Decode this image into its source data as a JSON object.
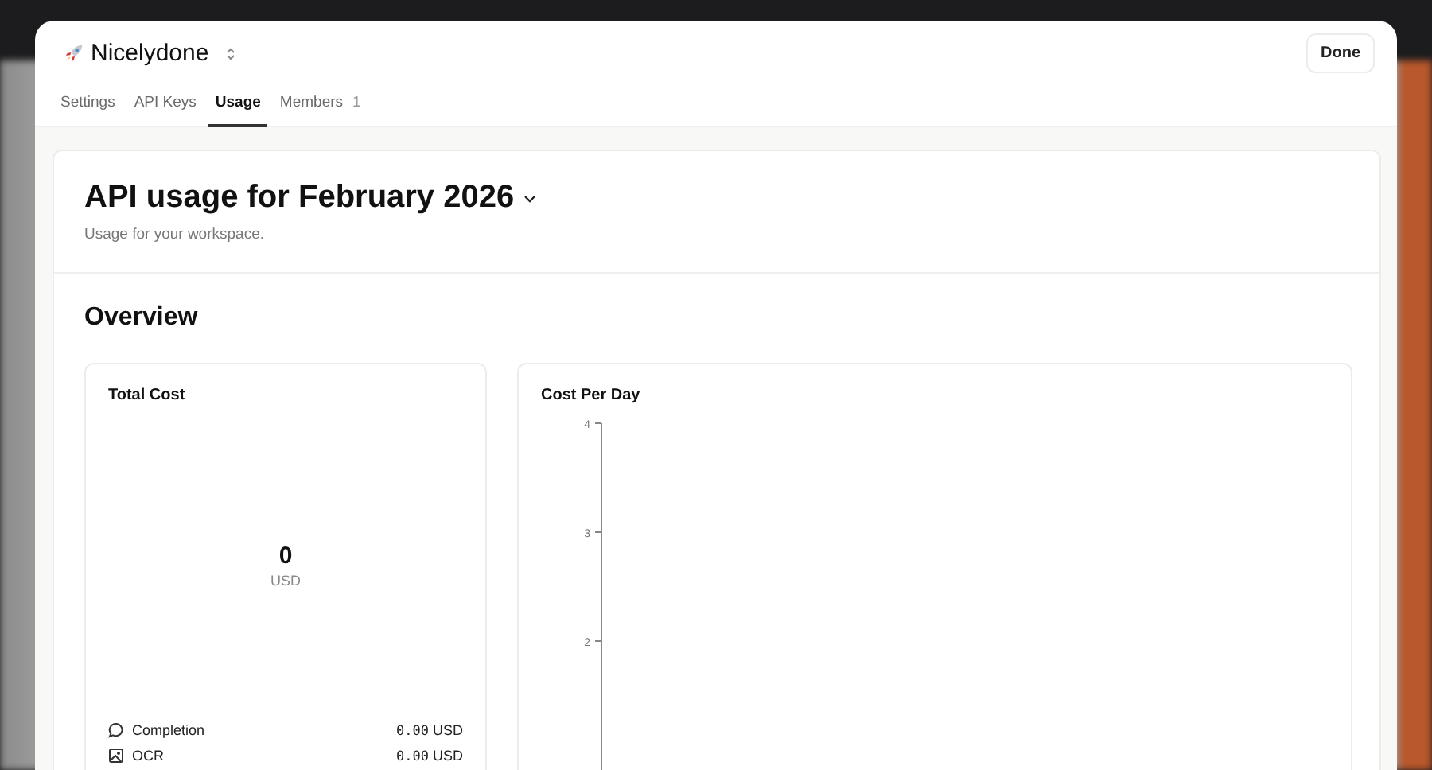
{
  "workspace": {
    "name": "Nicelydone"
  },
  "done_button": "Done",
  "tabs": [
    {
      "label": "Settings",
      "selected": false
    },
    {
      "label": "API Keys",
      "selected": false
    },
    {
      "label": "Usage",
      "selected": true
    },
    {
      "label": "Members",
      "selected": false,
      "count": "1"
    }
  ],
  "header": {
    "title": "API usage for February 2026",
    "subtitle": "Usage for your workspace."
  },
  "overview": {
    "title": "Overview",
    "total_cost": {
      "title": "Total Cost",
      "value": "0",
      "unit": "USD",
      "items": [
        {
          "kind": "chat",
          "label": "Completion",
          "amount": "0.00",
          "unit": "USD"
        },
        {
          "kind": "image",
          "label": "OCR",
          "amount": "0.00",
          "unit": "USD"
        }
      ]
    },
    "cost_per_day": {
      "title": "Cost Per Day",
      "axis_labels": [
        "4",
        "3",
        "2"
      ]
    }
  }
}
